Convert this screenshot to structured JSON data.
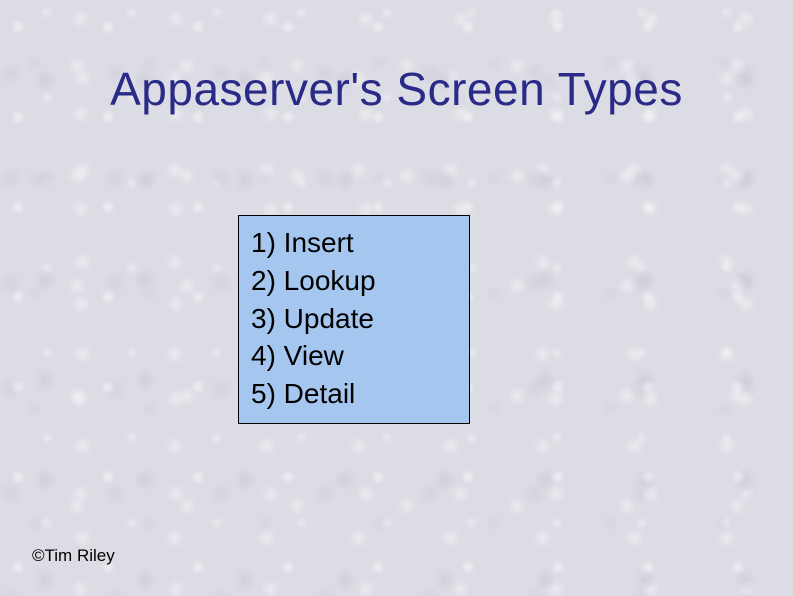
{
  "title": "Appaserver's Screen Types",
  "list": {
    "items": [
      {
        "text": "1) Insert"
      },
      {
        "text": "2) Lookup"
      },
      {
        "text": "3) Update"
      },
      {
        "text": "4) View"
      },
      {
        "text": "5) Detail"
      }
    ]
  },
  "copyright": "©Tim Riley"
}
